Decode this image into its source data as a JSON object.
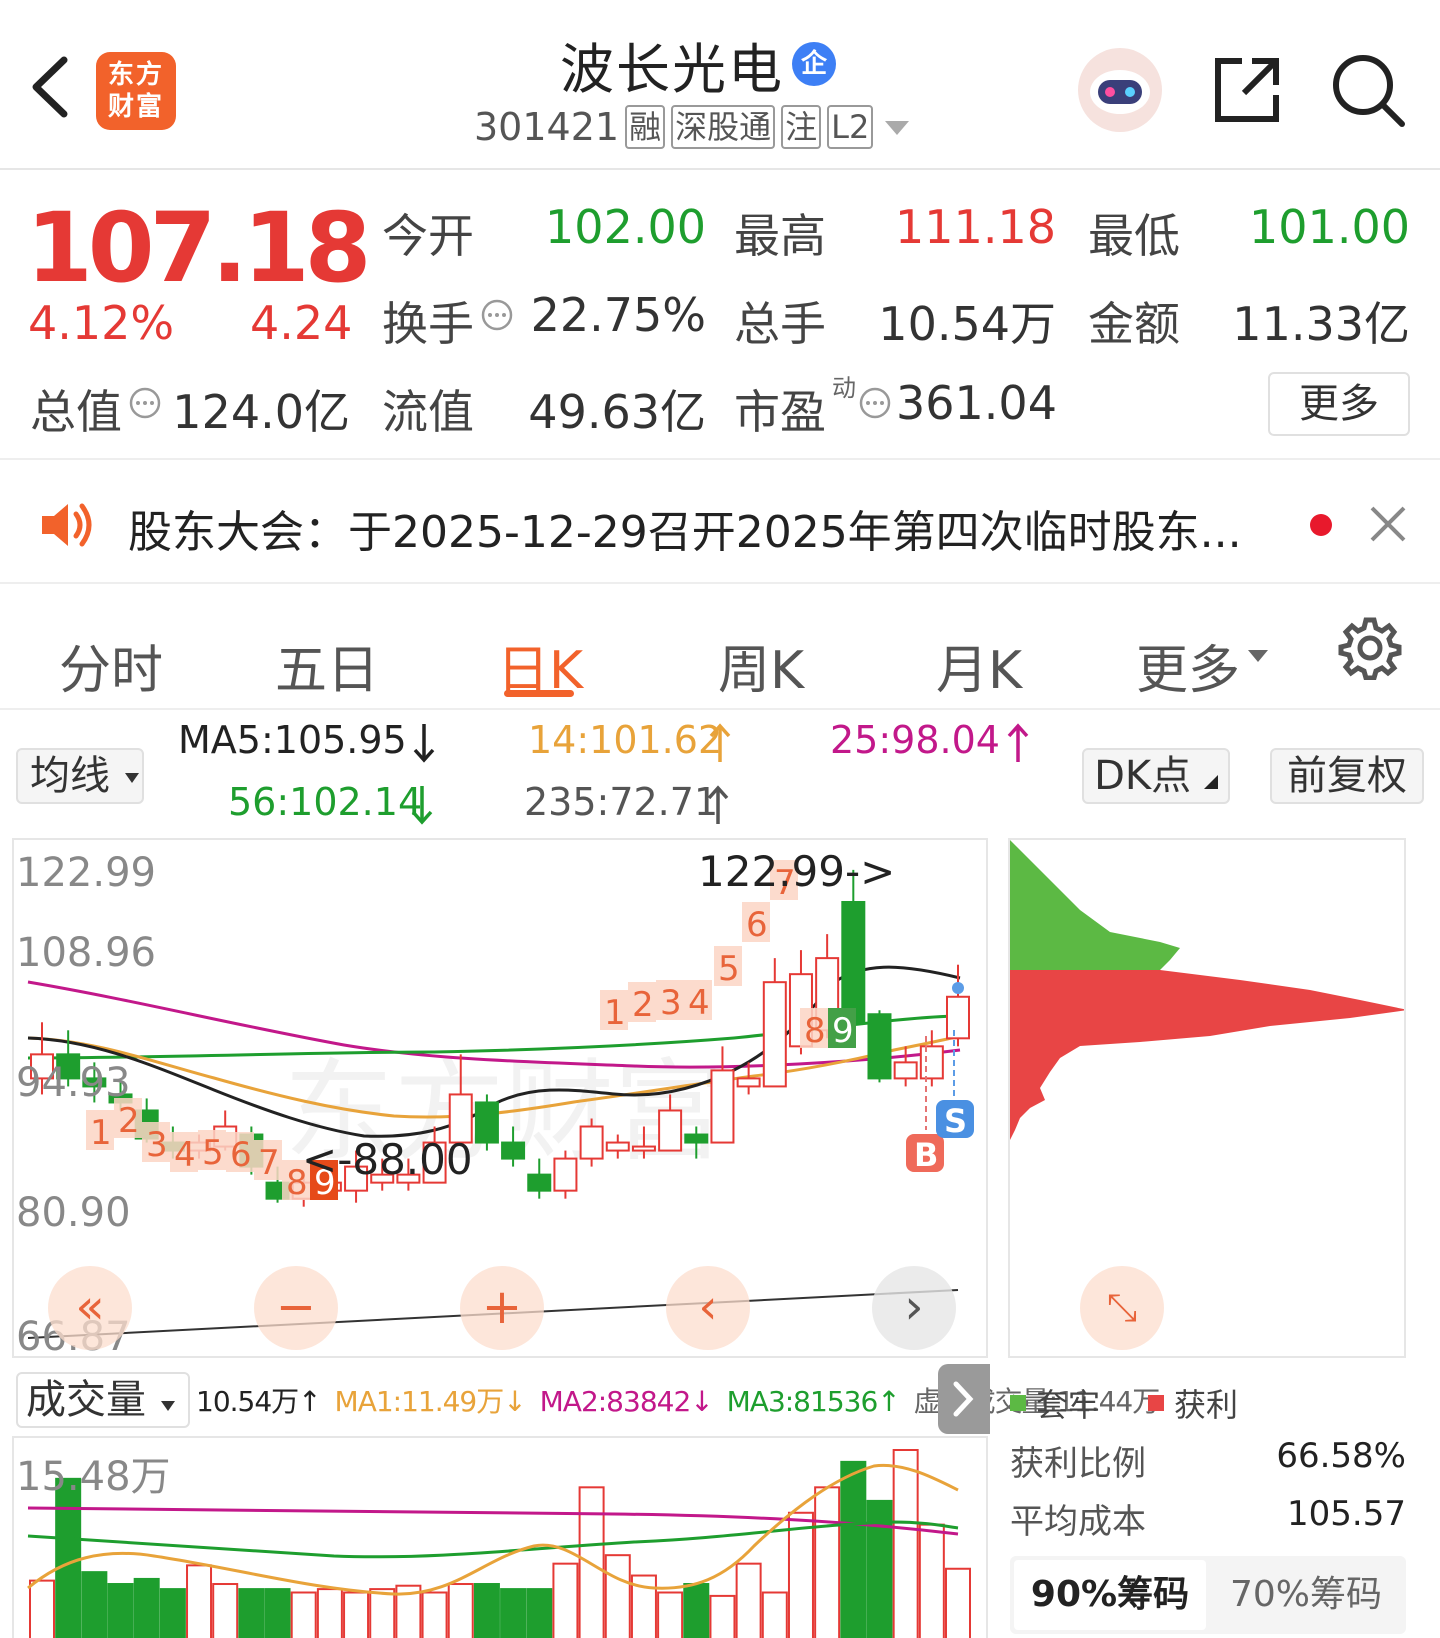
{
  "header": {
    "back_icon": "chevron-left-icon",
    "logo_text": "东方财富",
    "title": "波长光电",
    "badge": "企",
    "code": "301421",
    "tags": [
      "融",
      "深股通",
      "注",
      "L2"
    ],
    "robot_icon": "robot-assistant-icon",
    "share_icon": "share-icon",
    "search_icon": "search-icon"
  },
  "quote": {
    "price": "107.18",
    "pct": "4.12%",
    "chg": "4.24",
    "open_label": "今开",
    "open": "102.00",
    "high_label": "最高",
    "high": "111.18",
    "low_label": "最低",
    "low": "101.00",
    "turnover_label": "换手",
    "turnover": "22.75%",
    "vol_label": "总手",
    "vol": "10.54万",
    "amount_label": "金额",
    "amount": "11.33亿",
    "mcap_label": "总值",
    "mcap": "124.0亿",
    "float_label": "流值",
    "float": "49.63亿",
    "pe_label": "市盈",
    "pe_sup": "动",
    "pe": "361.04",
    "more": "更多",
    "colors": {
      "up": "#e53935",
      "down": "#1e9e2e"
    }
  },
  "notice": {
    "text": "股东大会：于2025-12-29召开2025年第四次临时股东..."
  },
  "tabs": {
    "items": [
      "分时",
      "五日",
      "日K",
      "周K",
      "月K",
      "更多"
    ],
    "active": 2
  },
  "ma": {
    "selector": "均线",
    "ma5": "MA5:105.95",
    "ma14": "14:101.62",
    "ma25": "25:98.04",
    "ma56": "56:102.14",
    "ma235": "235:72.71",
    "dk": "DK点",
    "adj": "前复权"
  },
  "kline": {
    "ylabels": [
      "122.99",
      "108.96",
      "94.93",
      "80.90",
      "66.87"
    ],
    "hi_label": "122.99->",
    "lo_label": "<-88.00",
    "watermark": "东方财富",
    "buy": "B",
    "sell": "S",
    "seq_a": [
      "1",
      "2",
      "3",
      "4",
      "5",
      "6",
      "7",
      "8",
      "9"
    ],
    "seq_b": [
      "1",
      "2",
      "3",
      "4",
      "5",
      "6",
      "7",
      "8",
      "9"
    ]
  },
  "volume": {
    "selector": "成交量",
    "vol": "10.54万↑",
    "ma1": "MA1:11.49万↓",
    "ma2": "MA2:83842↓",
    "ma3": "MA3:81536↑",
    "virt": "虚拟成交量:11.44万",
    "ymax": "15.48万"
  },
  "chips": {
    "legend_loss": "套牢",
    "legend_gain": "获利",
    "ratio_label": "获利比例",
    "ratio": "66.58%",
    "cost_label": "平均成本",
    "cost": "105.57",
    "tab90": "90%筹码",
    "tab70": "70%筹码"
  },
  "chart_data": {
    "type": "candlestick",
    "y_axis": [
      66.87,
      80.9,
      94.93,
      108.96,
      122.99
    ],
    "high_mark": 122.99,
    "low_mark": 88.0,
    "candles": [
      {
        "o": 97,
        "c": 100,
        "h": 104,
        "l": 95
      },
      {
        "o": 100,
        "c": 97,
        "h": 103,
        "l": 96
      },
      {
        "o": 97,
        "c": 96,
        "h": 99,
        "l": 94
      },
      {
        "o": 95,
        "c": 94,
        "h": 97,
        "l": 93
      },
      {
        "o": 93,
        "c": 89.5,
        "h": 94.5,
        "l": 89
      },
      {
        "o": 89,
        "c": 88,
        "h": 91,
        "l": 87
      },
      {
        "o": 88,
        "c": 89,
        "h": 90,
        "l": 87
      },
      {
        "o": 88.5,
        "c": 91,
        "h": 93,
        "l": 88
      },
      {
        "o": 90,
        "c": 86,
        "h": 91,
        "l": 85
      },
      {
        "o": 84,
        "c": 82,
        "h": 86,
        "l": 81.5
      },
      {
        "o": 82,
        "c": 84,
        "h": 85,
        "l": 81
      },
      {
        "o": 83,
        "c": 84,
        "h": 86,
        "l": 82.5
      },
      {
        "o": 83,
        "c": 86,
        "h": 88,
        "l": 81.5
      },
      {
        "o": 84,
        "c": 85,
        "h": 87,
        "l": 83
      },
      {
        "o": 84,
        "c": 85,
        "h": 87,
        "l": 83
      },
      {
        "o": 84,
        "c": 89,
        "h": 91,
        "l": 84
      },
      {
        "o": 89,
        "c": 95,
        "h": 100,
        "l": 89
      },
      {
        "o": 94,
        "c": 89,
        "h": 95,
        "l": 88
      },
      {
        "o": 89,
        "c": 87,
        "h": 91,
        "l": 86
      },
      {
        "o": 85,
        "c": 83,
        "h": 87,
        "l": 82
      },
      {
        "o": 83,
        "c": 87,
        "h": 88,
        "l": 82
      },
      {
        "o": 87,
        "c": 91,
        "h": 92,
        "l": 86
      },
      {
        "o": 88,
        "c": 89,
        "h": 90,
        "l": 87
      },
      {
        "o": 88,
        "c": 88.5,
        "h": 91,
        "l": 87
      },
      {
        "o": 88,
        "c": 93,
        "h": 95,
        "l": 88
      },
      {
        "o": 90,
        "c": 89,
        "h": 91,
        "l": 87
      },
      {
        "o": 89,
        "c": 98,
        "h": 101,
        "l": 89
      },
      {
        "o": 96,
        "c": 97,
        "h": 99,
        "l": 95
      },
      {
        "o": 96,
        "c": 109,
        "h": 112,
        "l": 96
      },
      {
        "o": 101,
        "c": 110,
        "h": 113,
        "l": 100
      },
      {
        "o": 103,
        "c": 112,
        "h": 115,
        "l": 102
      },
      {
        "o": 119,
        "c": 104,
        "h": 123,
        "l": 104
      },
      {
        "o": 105,
        "c": 97,
        "h": 105.5,
        "l": 96.5
      },
      {
        "o": 97,
        "c": 99,
        "h": 101,
        "l": 96
      },
      {
        "o": 97,
        "c": 101,
        "h": 103,
        "l": 96
      },
      {
        "o": 102,
        "c": 107.18,
        "h": 111.18,
        "l": 101
      }
    ],
    "volumes": [
      0.35,
      0.95,
      0.4,
      0.33,
      0.36,
      0.3,
      0.44,
      0.33,
      0.3,
      0.3,
      0.28,
      0.3,
      0.28,
      0.3,
      0.32,
      0.28,
      0.33,
      0.33,
      0.3,
      0.3,
      0.45,
      0.9,
      0.5,
      0.38,
      0.28,
      0.33,
      0.26,
      0.45,
      0.28,
      0.75,
      0.9,
      1.05,
      0.82,
      1.12,
      0.68,
      0.42
    ]
  }
}
